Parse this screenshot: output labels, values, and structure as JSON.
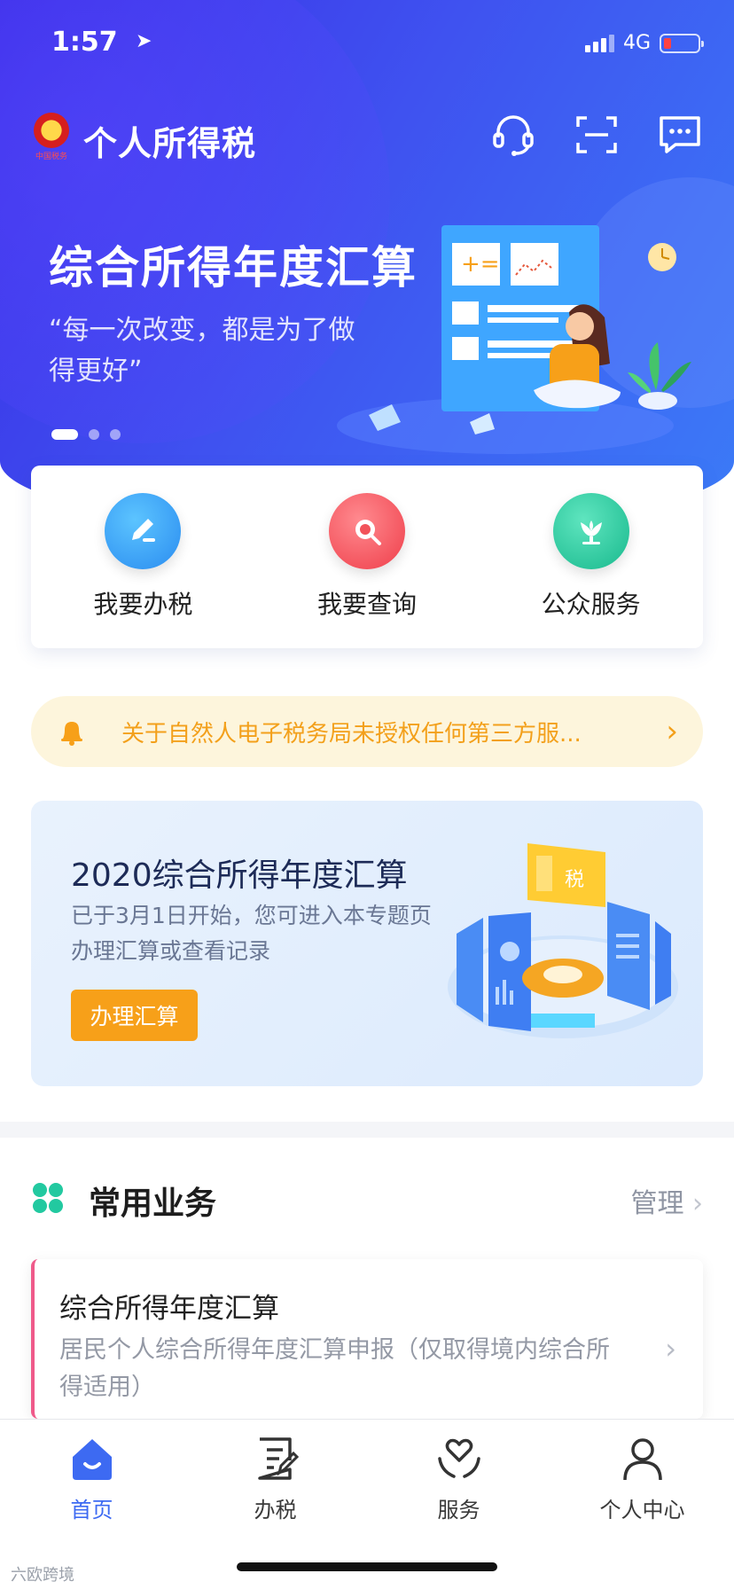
{
  "status_bar": {
    "time": "1:57",
    "network": "4G"
  },
  "header": {
    "app_title": "个人所得税",
    "emblem_caption": "中国税务"
  },
  "banner": {
    "title": "综合所得年度汇算",
    "subtitle": "“每一次改变，都是为了做得更好”",
    "pager": {
      "total": 3,
      "active": 1
    }
  },
  "quick_actions": [
    {
      "label": "我要办税",
      "icon": "pencil-icon",
      "color": "#3aa0f7"
    },
    {
      "label": "我要查询",
      "icon": "search-icon",
      "color": "#f2535a"
    },
    {
      "label": "公众服务",
      "icon": "flower-icon",
      "color": "#22c9a0"
    }
  ],
  "notice": {
    "text": "关于自然人电子税务局未授权任何第三方服..."
  },
  "promo": {
    "title": "2020综合所得年度汇算",
    "description": "已于3月1日开始，您可进入本专题页办理汇算或查看记录",
    "button_label": "办理汇算",
    "art_label": "税"
  },
  "common_business": {
    "title": "常用业务",
    "manage_label": "管理",
    "items": [
      {
        "title": "综合所得年度汇算",
        "description": "居民个人综合所得年度汇算申报（仅取得境内综合所得适用）"
      }
    ]
  },
  "tab_bar": {
    "tabs": [
      {
        "label": "首页",
        "icon": "home-icon",
        "active": true
      },
      {
        "label": "办税",
        "icon": "document-icon",
        "active": false
      },
      {
        "label": "服务",
        "icon": "heart-hands-icon",
        "active": false
      },
      {
        "label": "个人中心",
        "icon": "person-icon",
        "active": false
      }
    ]
  },
  "watermark": "六欧跨境",
  "colors": {
    "hero_start": "#3a2ee6",
    "hero_end": "#3b7bf7",
    "accent_blue": "#3d6af2",
    "accent_orange": "#f7a019",
    "notice_bg": "#fdf5dc"
  }
}
